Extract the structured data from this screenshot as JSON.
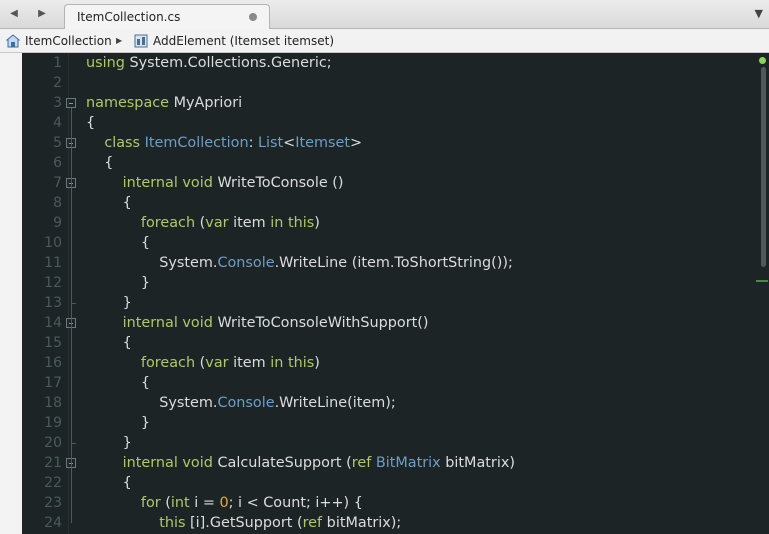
{
  "tab": {
    "title": "ItemCollection.cs"
  },
  "breadcrumb": {
    "class_name": "ItemCollection",
    "member_name": "AddElement (Itemset itemset)"
  },
  "colors": {
    "background": "#1d2426",
    "keyword": "#b0c86a",
    "type": "#6c9ec6",
    "number": "#f0a830",
    "text": "#dcdcdc",
    "line_number": "#4a5a5c"
  },
  "icons": {
    "back": "back-arrow-icon",
    "forward": "forward-arrow-icon",
    "close": "close-tab-icon",
    "menu": "dropdown-icon",
    "namespace": "namespace-icon",
    "method": "method-icon"
  },
  "line_numbers": [
    "1",
    "2",
    "3",
    "4",
    "5",
    "6",
    "7",
    "8",
    "9",
    "10",
    "11",
    "12",
    "13",
    "14",
    "15",
    "16",
    "17",
    "18",
    "19",
    "20",
    "21",
    "22",
    "23",
    "24"
  ],
  "code": [
    [
      {
        "t": "using",
        "c": "kw"
      },
      {
        "t": " System.Collections.Generic;",
        "c": "pl"
      }
    ],
    [],
    [
      {
        "t": "namespace",
        "c": "kw"
      },
      {
        "t": " MyApriori",
        "c": "pl"
      }
    ],
    [
      {
        "t": "{",
        "c": "pl"
      }
    ],
    [
      {
        "t": "    ",
        "c": "pl"
      },
      {
        "t": "class",
        "c": "kw"
      },
      {
        "t": " ",
        "c": "pl"
      },
      {
        "t": "ItemCollection",
        "c": "ty"
      },
      {
        "t": ": ",
        "c": "pl"
      },
      {
        "t": "List",
        "c": "ty"
      },
      {
        "t": "<",
        "c": "pl"
      },
      {
        "t": "Itemset",
        "c": "ty"
      },
      {
        "t": ">",
        "c": "pl"
      }
    ],
    [
      {
        "t": "    {",
        "c": "pl"
      }
    ],
    [
      {
        "t": "        ",
        "c": "pl"
      },
      {
        "t": "internal",
        "c": "kw"
      },
      {
        "t": " ",
        "c": "pl"
      },
      {
        "t": "void",
        "c": "kw"
      },
      {
        "t": " WriteToConsole ()",
        "c": "pl"
      }
    ],
    [
      {
        "t": "        {",
        "c": "pl"
      }
    ],
    [
      {
        "t": "            ",
        "c": "pl"
      },
      {
        "t": "foreach",
        "c": "kw"
      },
      {
        "t": " (",
        "c": "pl"
      },
      {
        "t": "var",
        "c": "kw"
      },
      {
        "t": " item ",
        "c": "pl"
      },
      {
        "t": "in",
        "c": "kw"
      },
      {
        "t": " ",
        "c": "pl"
      },
      {
        "t": "this",
        "c": "kw"
      },
      {
        "t": ")",
        "c": "pl"
      }
    ],
    [
      {
        "t": "            {",
        "c": "pl"
      }
    ],
    [
      {
        "t": "                System.",
        "c": "pl"
      },
      {
        "t": "Console",
        "c": "ty"
      },
      {
        "t": ".WriteLine (item.ToShortString());",
        "c": "pl"
      }
    ],
    [
      {
        "t": "            }",
        "c": "pl"
      }
    ],
    [
      {
        "t": "        }",
        "c": "pl"
      }
    ],
    [
      {
        "t": "        ",
        "c": "pl"
      },
      {
        "t": "internal",
        "c": "kw"
      },
      {
        "t": " ",
        "c": "pl"
      },
      {
        "t": "void",
        "c": "kw"
      },
      {
        "t": " WriteToConsoleWithSupport()",
        "c": "pl"
      }
    ],
    [
      {
        "t": "        {",
        "c": "pl"
      }
    ],
    [
      {
        "t": "            ",
        "c": "pl"
      },
      {
        "t": "foreach",
        "c": "kw"
      },
      {
        "t": " (",
        "c": "pl"
      },
      {
        "t": "var",
        "c": "kw"
      },
      {
        "t": " item ",
        "c": "pl"
      },
      {
        "t": "in",
        "c": "kw"
      },
      {
        "t": " ",
        "c": "pl"
      },
      {
        "t": "this",
        "c": "kw"
      },
      {
        "t": ")",
        "c": "pl"
      }
    ],
    [
      {
        "t": "            {",
        "c": "pl"
      }
    ],
    [
      {
        "t": "                System.",
        "c": "pl"
      },
      {
        "t": "Console",
        "c": "ty"
      },
      {
        "t": ".WriteLine(item);",
        "c": "pl"
      }
    ],
    [
      {
        "t": "            }",
        "c": "pl"
      }
    ],
    [
      {
        "t": "        }",
        "c": "pl"
      }
    ],
    [
      {
        "t": "        ",
        "c": "pl"
      },
      {
        "t": "internal",
        "c": "kw"
      },
      {
        "t": " ",
        "c": "pl"
      },
      {
        "t": "void",
        "c": "kw"
      },
      {
        "t": " CalculateSupport (",
        "c": "pl"
      },
      {
        "t": "ref",
        "c": "kw"
      },
      {
        "t": " ",
        "c": "pl"
      },
      {
        "t": "BitMatrix",
        "c": "ty"
      },
      {
        "t": " bitMatrix)",
        "c": "pl"
      }
    ],
    [
      {
        "t": "        {",
        "c": "pl"
      }
    ],
    [
      {
        "t": "            ",
        "c": "pl"
      },
      {
        "t": "for",
        "c": "kw"
      },
      {
        "t": " (",
        "c": "pl"
      },
      {
        "t": "int",
        "c": "kw"
      },
      {
        "t": " i = ",
        "c": "pl"
      },
      {
        "t": "0",
        "c": "num"
      },
      {
        "t": "; i < Count; i++) {",
        "c": "pl"
      }
    ],
    [
      {
        "t": "                ",
        "c": "pl"
      },
      {
        "t": "this",
        "c": "kw"
      },
      {
        "t": " [i].GetSupport (",
        "c": "pl"
      },
      {
        "t": "ref",
        "c": "kw"
      },
      {
        "t": " bitMatrix);",
        "c": "pl"
      }
    ]
  ]
}
